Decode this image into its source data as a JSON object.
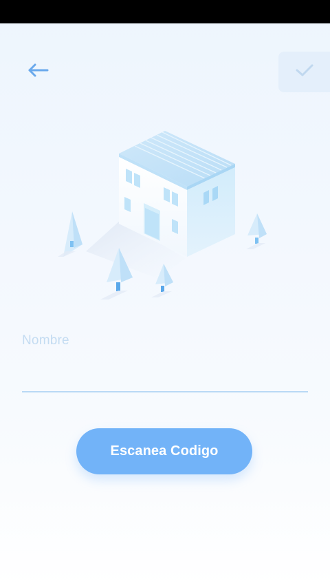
{
  "header": {
    "back_icon": "arrow-left-icon",
    "confirm_icon": "check-icon"
  },
  "form": {
    "name_label": "Nombre",
    "name_value": ""
  },
  "actions": {
    "scan_label": "Escanea Codigo"
  },
  "colors": {
    "accent": "#72b3f8",
    "icon": "#6aa9ec",
    "underline": "#b9d9f5",
    "label": "#c4dcf2",
    "confirm_bg": "#e4effb"
  },
  "illustration": {
    "icon": "house-with-trees-illustration"
  }
}
